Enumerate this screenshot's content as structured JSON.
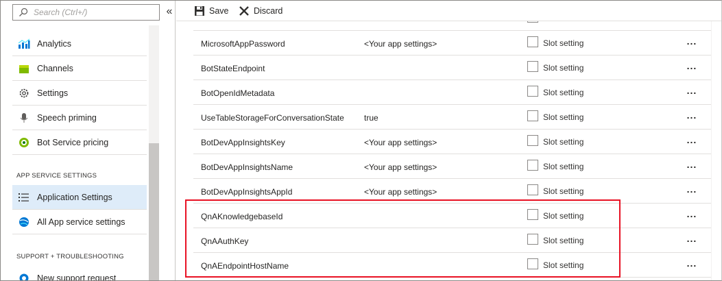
{
  "sidebar": {
    "search_placeholder": "Search (Ctrl+/)",
    "collapse_label": "«",
    "items": [
      {
        "label": "Analytics",
        "icon": "analytics-icon"
      },
      {
        "label": "Channels",
        "icon": "channels-icon"
      },
      {
        "label": "Settings",
        "icon": "gear-icon"
      },
      {
        "label": "Speech priming",
        "icon": "microphone-icon"
      },
      {
        "label": "Bot Service pricing",
        "icon": "pricing-icon"
      }
    ],
    "app_service_header": "APP SERVICE SETTINGS",
    "app_service_items": [
      {
        "label": "Application Settings",
        "icon": "list-icon",
        "active": true
      },
      {
        "label": "All App service settings",
        "icon": "app-service-icon",
        "active": false
      }
    ],
    "support_header": "SUPPORT + TROUBLESHOOTING",
    "support_items": [
      {
        "label": "New support request",
        "icon": "support-icon"
      }
    ]
  },
  "toolbar": {
    "save_label": "Save",
    "discard_label": "Discard"
  },
  "settings": {
    "checkbox_label": "Slot setting",
    "more_label": "...",
    "rows": [
      {
        "name": "MicrosoftAppPassword",
        "value": "<Your app settings>",
        "checked": false
      },
      {
        "name": "BotStateEndpoint",
        "value": "",
        "checked": false
      },
      {
        "name": "BotOpenIdMetadata",
        "value": "",
        "checked": false
      },
      {
        "name": "UseTableStorageForConversationState",
        "value": "true",
        "checked": false
      },
      {
        "name": "BotDevAppInsightsKey",
        "value": "<Your app settings>",
        "checked": false
      },
      {
        "name": "BotDevAppInsightsName",
        "value": "<Your app settings>",
        "checked": false
      },
      {
        "name": "BotDevAppInsightsAppId",
        "value": "<Your app settings>",
        "checked": false
      },
      {
        "name": "QnAKnowledgebaseId",
        "value": "",
        "checked": false
      },
      {
        "name": "QnAAuthKey",
        "value": "",
        "checked": false
      },
      {
        "name": "QnAEndpointHostName",
        "value": "",
        "checked": false
      }
    ]
  },
  "colors": {
    "accent": "#0078d4",
    "active_bg": "#deecf9",
    "highlight_border": "#e81123"
  }
}
